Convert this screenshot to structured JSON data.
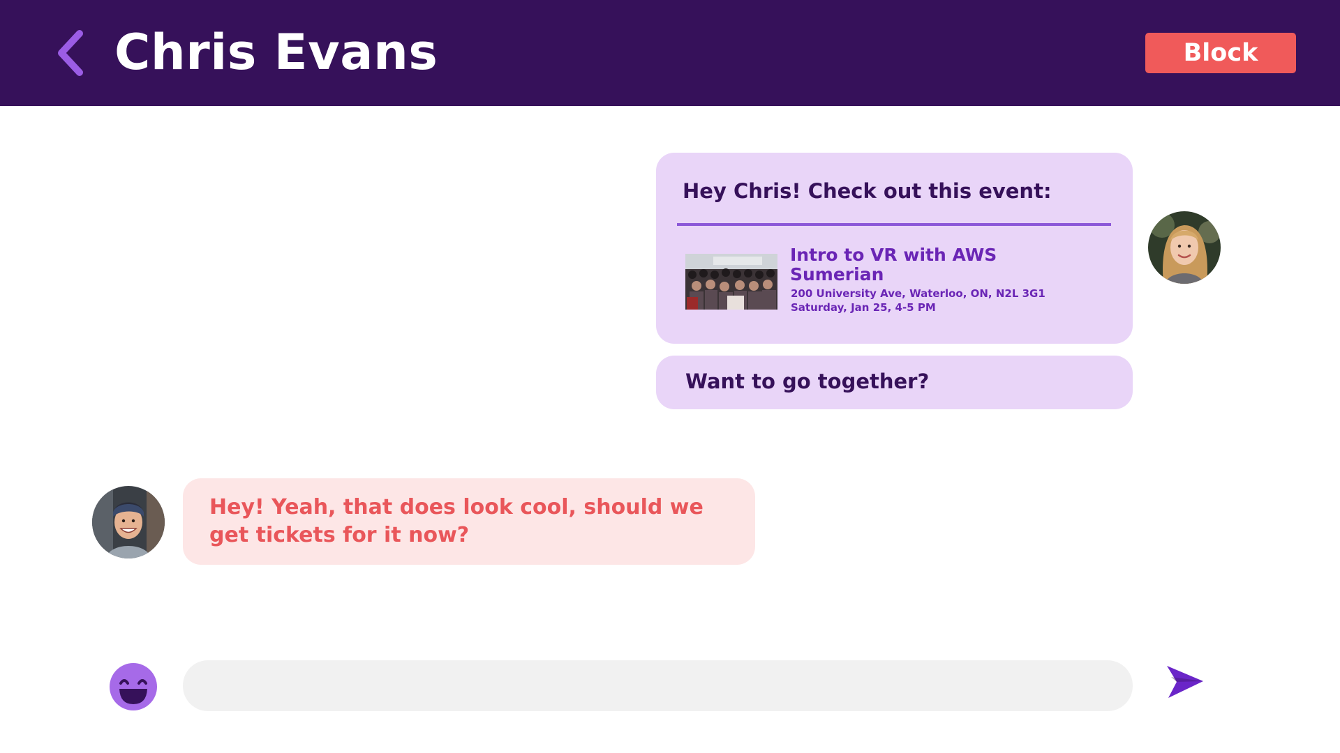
{
  "header": {
    "title": "Chris Evans",
    "block_label": "Block",
    "back_icon": "chevron-left-icon",
    "background": "#36115a",
    "block_color": "#f05a5a"
  },
  "messages": {
    "event_intro": "Hey Chris! Check out this event:",
    "event": {
      "title": "Intro to VR with AWS Sumerian",
      "address": "200 University Ave, Waterloo, ON, N2L 3G1",
      "time": "Saturday, Jan 25, 4-5 PM"
    },
    "together": "Want to go together?",
    "reply": "Hey! Yeah, that does look cool, should we get tickets for it now?"
  },
  "colors": {
    "outgoing_bubble": "#e9d5f8",
    "incoming_bubble": "#fde6e6",
    "incoming_text": "#e9565a",
    "accent": "#8b57d8"
  },
  "composer": {
    "input_value": "",
    "input_placeholder": "",
    "emoji_icon": "smiley-face-icon",
    "send_icon": "paper-plane-send-icon"
  }
}
